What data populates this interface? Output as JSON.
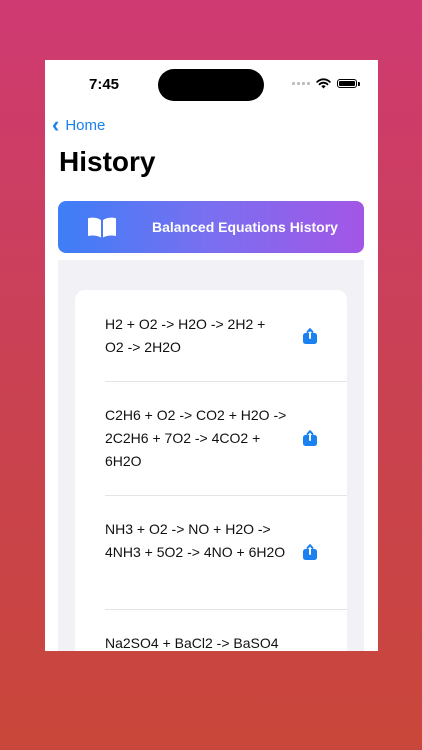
{
  "status_bar": {
    "time": "7:45"
  },
  "nav": {
    "back_label": "Home"
  },
  "page": {
    "title": "History"
  },
  "banner": {
    "label": "Balanced Equations History",
    "icon": "book-open-icon"
  },
  "history": {
    "items": [
      {
        "equation": "H2 + O2 -> H2O -> 2H2 + O2 -> 2H2O"
      },
      {
        "equation": "C2H6 + O2 -> CO2 + H2O -> 2C2H6 + 7O2 -> 4CO2 + 6H2O"
      },
      {
        "equation": "NH3 + O2 -> NO + H2O -> 4NH3 + 5O2 -> 4NO + 6H2O"
      },
      {
        "equation": "Na2SO4 + BaCl2 -> BaSO4"
      }
    ]
  },
  "colors": {
    "accent": "#1a82f0",
    "banner_start": "#3d7ef7",
    "banner_end": "#a356e6",
    "list_background": "#f1f1f6"
  }
}
